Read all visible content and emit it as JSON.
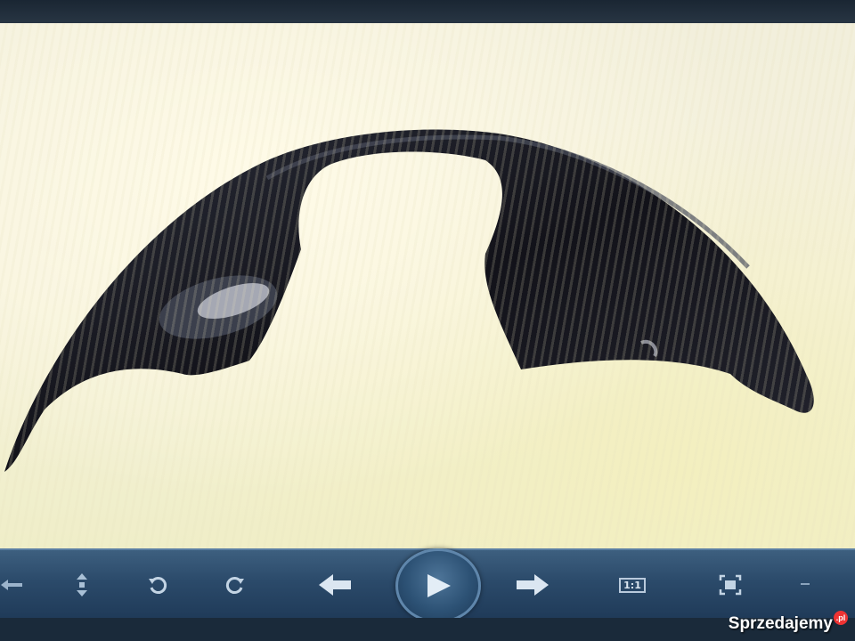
{
  "viewer": {
    "image_subject": "wheel-arch-liner",
    "toolbar": {
      "buttons": [
        {
          "name": "pan-left-icon"
        },
        {
          "name": "reorder-icon"
        },
        {
          "name": "rotate-left-icon"
        },
        {
          "name": "rotate-right-icon"
        },
        {
          "name": "previous-arrow-icon"
        },
        {
          "name": "play-icon"
        },
        {
          "name": "next-arrow-icon"
        },
        {
          "name": "actual-size-icon",
          "label": "1:1"
        },
        {
          "name": "fit-to-window-icon"
        },
        {
          "name": "minus-icon"
        }
      ]
    }
  },
  "watermark": {
    "text": "Sprzedajemy",
    "badge": ".pl"
  },
  "colors": {
    "toolbar": "#2b4a6a",
    "background": "#f4f1da",
    "part": "#15151c"
  }
}
